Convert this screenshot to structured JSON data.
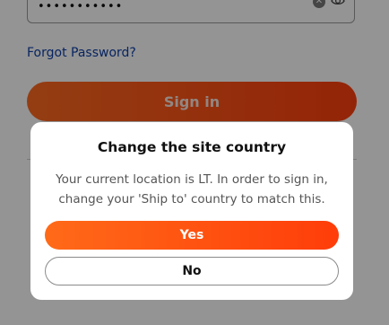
{
  "login": {
    "password_value": "•••••••••••",
    "forgot_password_label": "Forgot Password?",
    "sign_in_label": "Sign in"
  },
  "icons": {
    "clear": "clear-icon",
    "visibility": "eye-icon"
  },
  "dialog": {
    "title": "Change the site country",
    "message_line1": "Your current location is LT. In order to sign in,",
    "message_line2": "change your 'Ship to' country to match this.",
    "yes_label": "Yes",
    "no_label": "No"
  },
  "colors": {
    "accent_start": "#ff6a18",
    "accent_end": "#ff3d0a",
    "link": "#0d3ea8"
  }
}
